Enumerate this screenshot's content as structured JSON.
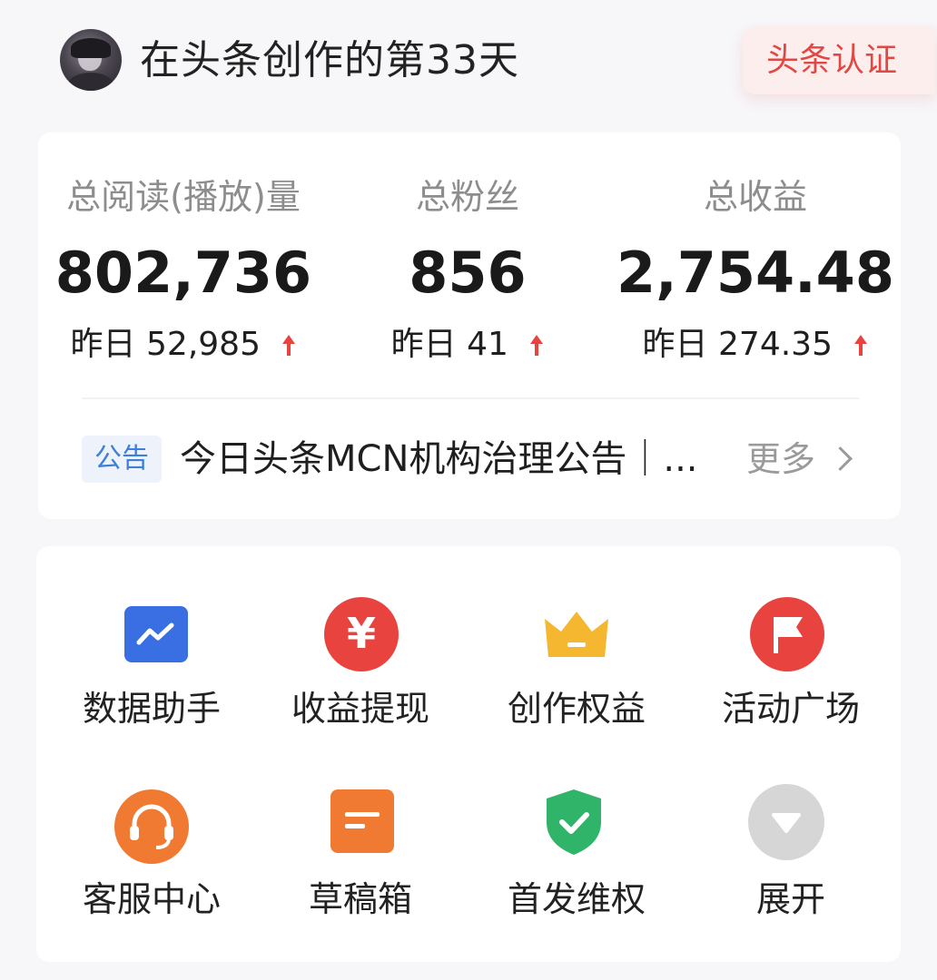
{
  "header": {
    "title": "在头条创作的第33天",
    "badge": "头条认证"
  },
  "stats": [
    {
      "label": "总阅读(播放)量",
      "value": "802,736",
      "delta_label": "昨日",
      "delta": "52,985"
    },
    {
      "label": "总粉丝",
      "value": "856",
      "delta_label": "昨日",
      "delta": "41"
    },
    {
      "label": "总收益",
      "value": "2,754.48",
      "delta_label": "昨日",
      "delta": "274.35"
    }
  ],
  "notice": {
    "tag": "公告",
    "text": "今日头条MCN机构治理公告｜...",
    "more": "更多"
  },
  "tools": [
    {
      "label": "数据助手",
      "icon": "chart-trend-icon",
      "color": "#3a6fe3"
    },
    {
      "label": "收益提现",
      "icon": "yen-icon",
      "color": "#e8433e",
      "glyph": "¥"
    },
    {
      "label": "创作权益",
      "icon": "crown-icon",
      "color": "#f5b630"
    },
    {
      "label": "活动广场",
      "icon": "flag-icon",
      "color": "#e8433e"
    },
    {
      "label": "客服中心",
      "icon": "headset-icon",
      "color": "#f07a32"
    },
    {
      "label": "草稿箱",
      "icon": "draft-icon",
      "color": "#f07a32"
    },
    {
      "label": "首发维权",
      "icon": "shield-check-icon",
      "color": "#2fb46a"
    },
    {
      "label": "展开",
      "icon": "expand-down-icon",
      "color": "#d6d6d6"
    }
  ],
  "colors": {
    "accent_red": "#e8433e",
    "notice_blue": "#3d7fd9",
    "label_gray": "#8d8d8d"
  }
}
